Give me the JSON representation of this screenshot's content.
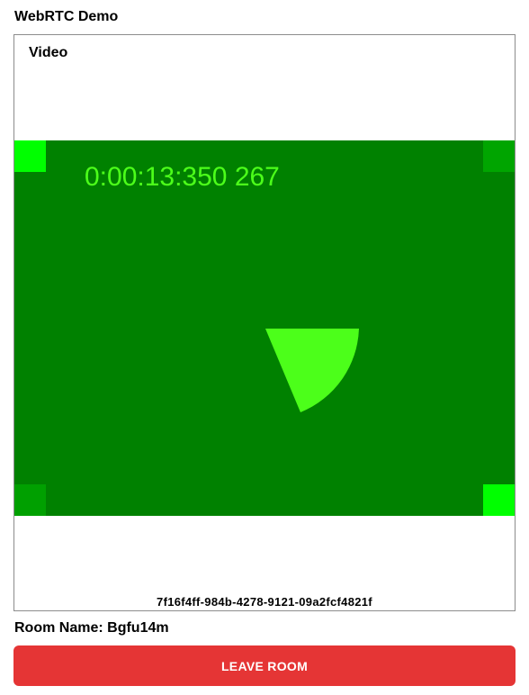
{
  "app": {
    "title": "WebRTC Demo"
  },
  "video": {
    "label": "Video",
    "timestamp": "0:00:13:350 267",
    "stream_id": "7f16f4ff-984b-4278-9121-09a2fcf4821f",
    "colors": {
      "frame_background": "#008100",
      "overlay_text": "#4cff1a",
      "sweep": "#4cff1a",
      "corner_bright": "#00ff00"
    }
  },
  "room": {
    "label": "Room Name:",
    "name": "Bgfu14m"
  },
  "actions": {
    "leave_label": "LEAVE ROOM",
    "leave_color": "#e53535"
  }
}
